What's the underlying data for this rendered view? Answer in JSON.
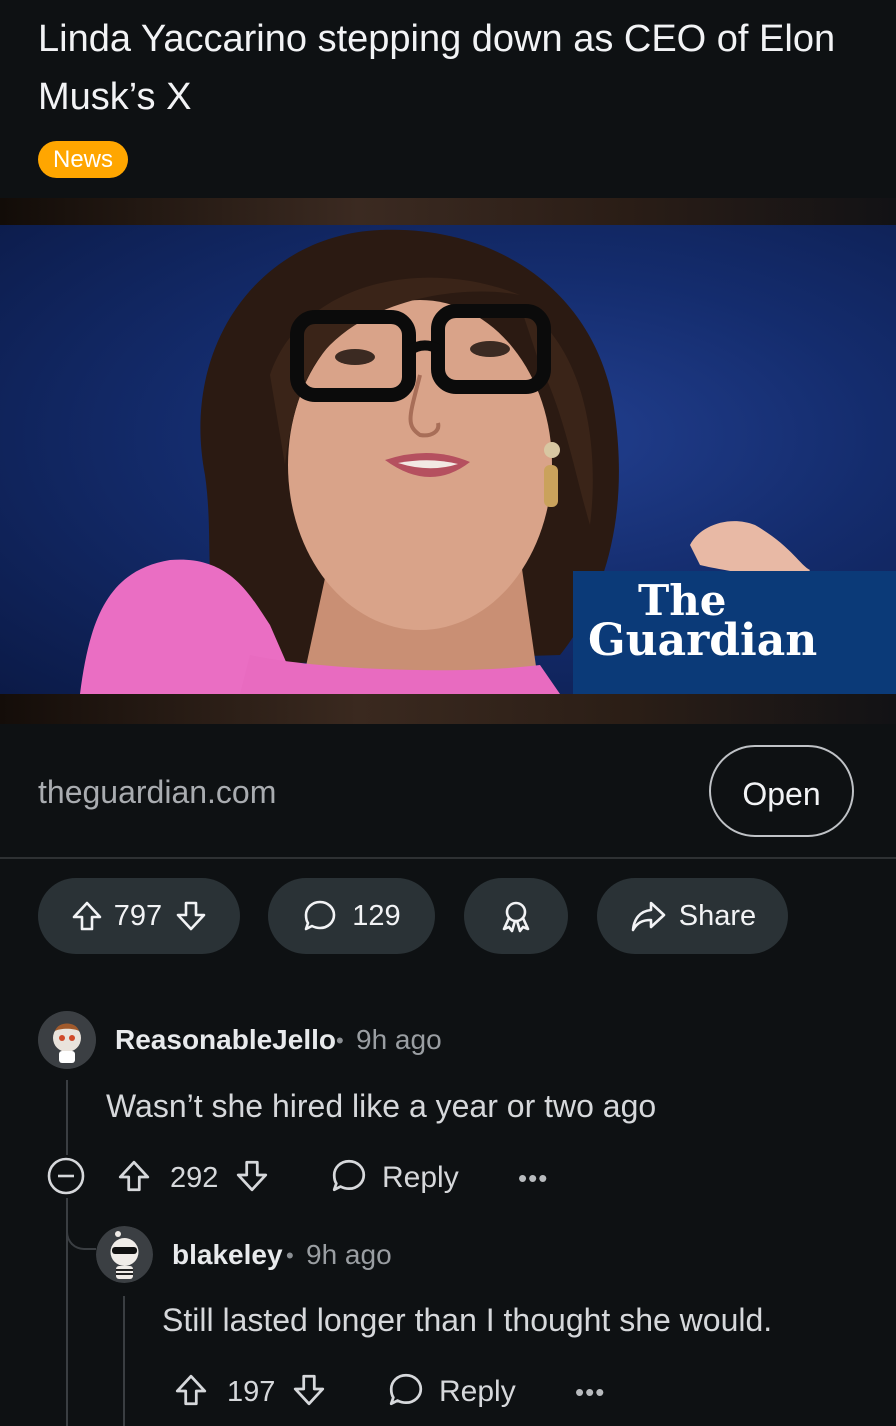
{
  "post": {
    "title": "Linda Yaccarino stepping down as CEO of Elon Musk’s X",
    "flair": "News",
    "flair_color": "#ffa600",
    "image_brand_line1": "The",
    "image_brand_line2": "Guardian",
    "link_domain": "theguardian.com",
    "open_label": "Open",
    "score": "797",
    "comment_count": "129",
    "share_label": "Share"
  },
  "comments": [
    {
      "author": "ReasonableJello",
      "separator": "•",
      "age": "9h ago",
      "body": "Wasn’t she hired like a year or two ago",
      "score": "292",
      "reply_label": "Reply",
      "more": "•••"
    },
    {
      "author": "blakeley",
      "separator": "•",
      "age": "9h ago",
      "body": "Still lasted longer than I thought she would.",
      "score": "197",
      "reply_label": "Reply",
      "more": "•••"
    }
  ],
  "colors": {
    "background": "#0e1113",
    "pill": "#2a3236",
    "guardian_blue": "#0b3a78"
  },
  "icons": [
    "upvote-icon",
    "downvote-icon",
    "comment-bubble-icon",
    "award-icon",
    "share-arrow-icon",
    "collapse-icon",
    "more-icon"
  ]
}
